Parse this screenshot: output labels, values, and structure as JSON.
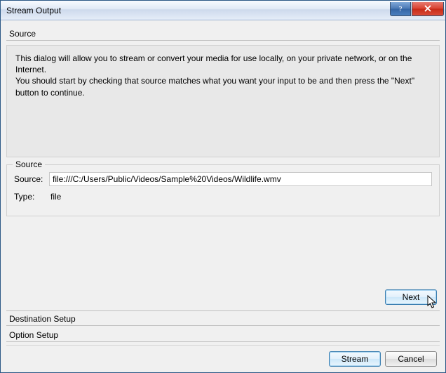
{
  "window": {
    "title": "Stream Output"
  },
  "source": {
    "heading": "Source",
    "info": "This dialog will allow you to stream or convert your media for use locally, on your private network, or on the Internet.\nYou should start by checking that source matches what you want your input to be and then press the \"Next\" button to continue.",
    "group_label": "Source",
    "source_label": "Source:",
    "source_value": "file:///C:/Users/Public/Videos/Sample%20Videos/Wildlife.wmv",
    "type_label": "Type:",
    "type_value": "file",
    "next_label": "Next"
  },
  "destination": {
    "heading": "Destination Setup"
  },
  "options": {
    "heading": "Option Setup"
  },
  "footer": {
    "stream_label": "Stream",
    "cancel_label": "Cancel"
  }
}
